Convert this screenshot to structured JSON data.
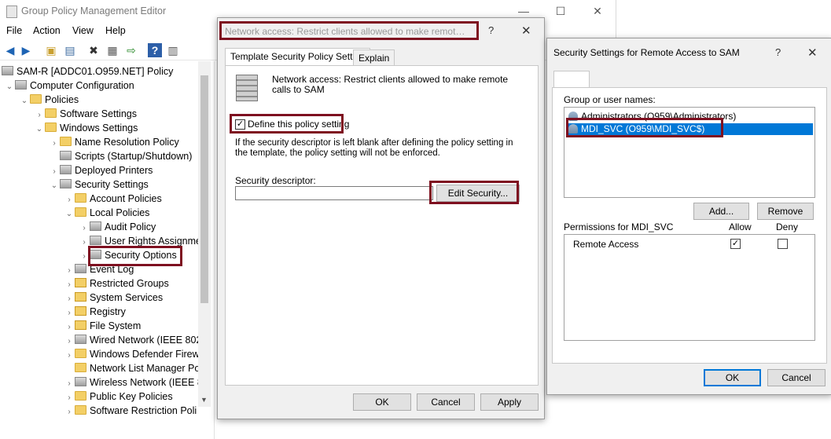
{
  "main_window": {
    "title": "Group Policy Management Editor",
    "controls": {
      "minimize": "—",
      "maximize": "☐",
      "close": "✕"
    },
    "menu": [
      "File",
      "Action",
      "View",
      "Help"
    ],
    "toolbar_icons": [
      "back-arrow-icon",
      "forward-arrow-icon",
      "up-folder-icon",
      "show-tree-icon",
      "delete-icon",
      "properties-icon",
      "export-icon",
      "help-icon",
      "view-icon"
    ]
  },
  "tree": {
    "root": "SAM-R [ADDC01.O959.NET] Policy",
    "items": [
      {
        "label": "Computer Configuration",
        "chev": "⌄"
      },
      {
        "label": "Policies",
        "chev": "⌄"
      },
      {
        "label": "Software Settings",
        "chev": "›"
      },
      {
        "label": "Windows Settings",
        "chev": "⌄"
      },
      {
        "label": "Name Resolution Policy",
        "chev": "›"
      },
      {
        "label": "Scripts (Startup/Shutdown)",
        "chev": ""
      },
      {
        "label": "Deployed Printers",
        "chev": "›"
      },
      {
        "label": "Security Settings",
        "chev": "⌄"
      },
      {
        "label": "Account Policies",
        "chev": "›"
      },
      {
        "label": "Local Policies",
        "chev": "⌄"
      },
      {
        "label": "Audit Policy",
        "chev": "›"
      },
      {
        "label": "User Rights Assignme",
        "chev": "›"
      },
      {
        "label": "Security Options",
        "chev": "›"
      },
      {
        "label": "Event Log",
        "chev": "›"
      },
      {
        "label": "Restricted Groups",
        "chev": "›"
      },
      {
        "label": "System Services",
        "chev": "›"
      },
      {
        "label": "Registry",
        "chev": "›"
      },
      {
        "label": "File System",
        "chev": "›"
      },
      {
        "label": "Wired Network (IEEE 802.",
        "chev": "›"
      },
      {
        "label": "Windows Defender Firew",
        "chev": "›"
      },
      {
        "label": "Network List Manager Po",
        "chev": ""
      },
      {
        "label": "Wireless Network (IEEE 80",
        "chev": "›"
      },
      {
        "label": "Public Key Policies",
        "chev": "›"
      },
      {
        "label": "Software Restriction Poli",
        "chev": "›"
      }
    ]
  },
  "policy_dialog": {
    "title": "Network access: Restrict clients allowed to make remote c...",
    "help": "?",
    "close": "✕",
    "tabs": [
      "Template Security Policy Setting",
      "Explain"
    ],
    "policy_name": "Network access: Restrict clients allowed to make remote calls to SAM",
    "define_label": "Define this policy setting",
    "define_checked": "✓",
    "note": "If the security descriptor is left blank after defining the policy setting in the template, the policy setting will not be enforced.",
    "descriptor_label": "Security descriptor:",
    "descriptor_value": "",
    "edit_security": "Edit Security...",
    "ok": "OK",
    "cancel": "Cancel",
    "apply": "Apply"
  },
  "security_dialog": {
    "title": "Security Settings for Remote Access to SAM",
    "help": "?",
    "close": "✕",
    "groups_label": "Group or user names:",
    "groups": [
      "Administrators (O959\\Administrators)",
      "MDI_SVC (O959\\MDI_SVC$)"
    ],
    "add": "Add...",
    "remove": "Remove",
    "permissions_label": "Permissions for MDI_SVC",
    "allow": "Allow",
    "deny": "Deny",
    "permissions": [
      {
        "name": "Remote Access",
        "allow": "✓",
        "deny": ""
      }
    ],
    "ok": "OK",
    "cancel": "Cancel"
  }
}
